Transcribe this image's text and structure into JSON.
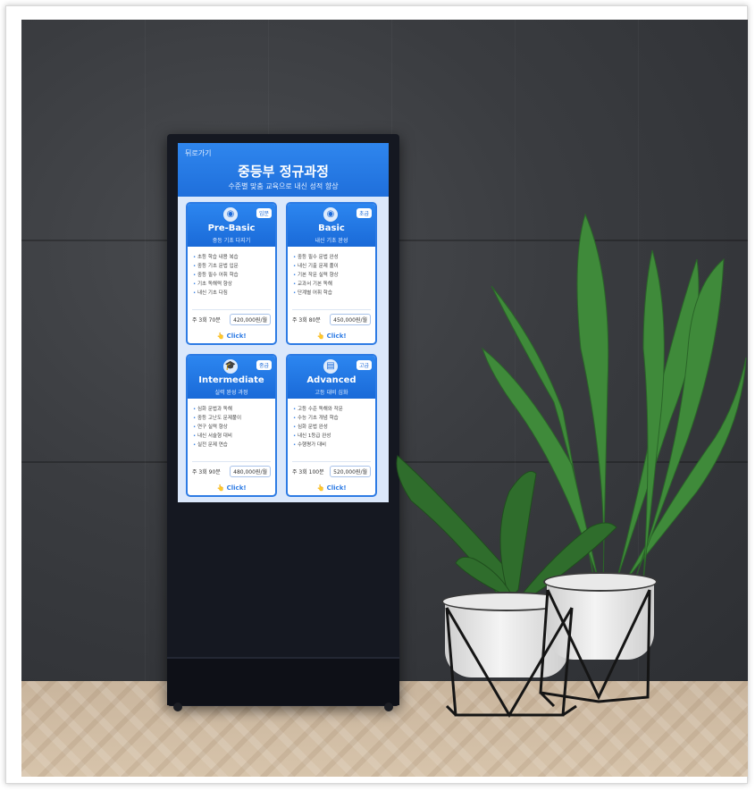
{
  "screen": {
    "back_label": "뒤로가기",
    "title": "중등부 정규과정",
    "subtitle": "수준별 맞춤 교육으로 내신 성적 향상"
  },
  "courses": [
    {
      "name": "Pre-Basic",
      "badge": "입문",
      "desc": "중등 기초 다지기",
      "icon": "globe-icon",
      "icon_glyph": "◉",
      "features": [
        "초등 학습 내용 복습",
        "중등 기초 문법 입문",
        "중등 필수 어휘 학습",
        "기초 독해력 향상",
        "내신 기초 다짐"
      ],
      "schedule": "주 3회 70분",
      "price": "420,000원/월",
      "cta": "Click!"
    },
    {
      "name": "Basic",
      "badge": "초급",
      "desc": "내신 기초 완성",
      "icon": "globe-icon",
      "icon_glyph": "◉",
      "features": [
        "중등 필수 문법 완성",
        "내신 기출 문제 풀이",
        "기본 작문 실력 향상",
        "교과서 기본 독해",
        "단계별 어휘 학습"
      ],
      "schedule": "주 3회 80분",
      "price": "450,000원/월",
      "cta": "Click!"
    },
    {
      "name": "Intermediate",
      "badge": "중급",
      "desc": "실력 완성 과정",
      "icon": "graduation-cap-icon",
      "icon_glyph": "🎓",
      "features": [
        "심화 문법과 독해",
        "중등 고난도 문제풀이",
        "연구 실력 향상",
        "내신 서술형 대비",
        "실전 문제 연습"
      ],
      "schedule": "주 3회 90분",
      "price": "480,000원/월",
      "cta": "Click!"
    },
    {
      "name": "Advanced",
      "badge": "고급",
      "desc": "고등 대비 심화",
      "icon": "document-icon",
      "icon_glyph": "▤",
      "features": [
        "고등 수준 독해와 작문",
        "수능 기초 개념 학습",
        "심화 문법 완성",
        "내신 1등급 완성",
        "수행평가 대비"
      ],
      "schedule": "주 3회 100분",
      "price": "520,000원/월",
      "cta": "Click!"
    }
  ],
  "colors": {
    "accent": "#2d7be4",
    "header": "#1f6fdb",
    "wall": "#3a3c40",
    "floor": "#d0bca3"
  }
}
